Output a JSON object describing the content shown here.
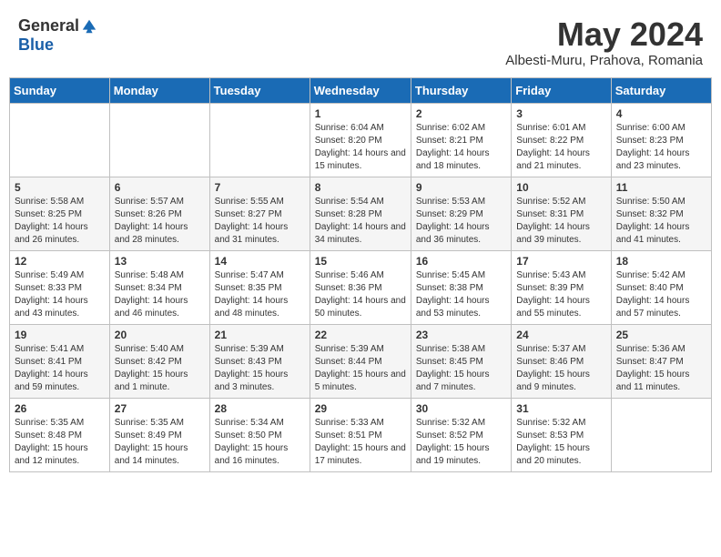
{
  "header": {
    "logo_general": "General",
    "logo_blue": "Blue",
    "month": "May 2024",
    "location": "Albesti-Muru, Prahova, Romania"
  },
  "days_of_week": [
    "Sunday",
    "Monday",
    "Tuesday",
    "Wednesday",
    "Thursday",
    "Friday",
    "Saturday"
  ],
  "weeks": [
    [
      {
        "day": "",
        "sunrise": "",
        "sunset": "",
        "daylight": ""
      },
      {
        "day": "",
        "sunrise": "",
        "sunset": "",
        "daylight": ""
      },
      {
        "day": "",
        "sunrise": "",
        "sunset": "",
        "daylight": ""
      },
      {
        "day": "1",
        "sunrise": "Sunrise: 6:04 AM",
        "sunset": "Sunset: 8:20 PM",
        "daylight": "Daylight: 14 hours and 15 minutes."
      },
      {
        "day": "2",
        "sunrise": "Sunrise: 6:02 AM",
        "sunset": "Sunset: 8:21 PM",
        "daylight": "Daylight: 14 hours and 18 minutes."
      },
      {
        "day": "3",
        "sunrise": "Sunrise: 6:01 AM",
        "sunset": "Sunset: 8:22 PM",
        "daylight": "Daylight: 14 hours and 21 minutes."
      },
      {
        "day": "4",
        "sunrise": "Sunrise: 6:00 AM",
        "sunset": "Sunset: 8:23 PM",
        "daylight": "Daylight: 14 hours and 23 minutes."
      }
    ],
    [
      {
        "day": "5",
        "sunrise": "Sunrise: 5:58 AM",
        "sunset": "Sunset: 8:25 PM",
        "daylight": "Daylight: 14 hours and 26 minutes."
      },
      {
        "day": "6",
        "sunrise": "Sunrise: 5:57 AM",
        "sunset": "Sunset: 8:26 PM",
        "daylight": "Daylight: 14 hours and 28 minutes."
      },
      {
        "day": "7",
        "sunrise": "Sunrise: 5:55 AM",
        "sunset": "Sunset: 8:27 PM",
        "daylight": "Daylight: 14 hours and 31 minutes."
      },
      {
        "day": "8",
        "sunrise": "Sunrise: 5:54 AM",
        "sunset": "Sunset: 8:28 PM",
        "daylight": "Daylight: 14 hours and 34 minutes."
      },
      {
        "day": "9",
        "sunrise": "Sunrise: 5:53 AM",
        "sunset": "Sunset: 8:29 PM",
        "daylight": "Daylight: 14 hours and 36 minutes."
      },
      {
        "day": "10",
        "sunrise": "Sunrise: 5:52 AM",
        "sunset": "Sunset: 8:31 PM",
        "daylight": "Daylight: 14 hours and 39 minutes."
      },
      {
        "day": "11",
        "sunrise": "Sunrise: 5:50 AM",
        "sunset": "Sunset: 8:32 PM",
        "daylight": "Daylight: 14 hours and 41 minutes."
      }
    ],
    [
      {
        "day": "12",
        "sunrise": "Sunrise: 5:49 AM",
        "sunset": "Sunset: 8:33 PM",
        "daylight": "Daylight: 14 hours and 43 minutes."
      },
      {
        "day": "13",
        "sunrise": "Sunrise: 5:48 AM",
        "sunset": "Sunset: 8:34 PM",
        "daylight": "Daylight: 14 hours and 46 minutes."
      },
      {
        "day": "14",
        "sunrise": "Sunrise: 5:47 AM",
        "sunset": "Sunset: 8:35 PM",
        "daylight": "Daylight: 14 hours and 48 minutes."
      },
      {
        "day": "15",
        "sunrise": "Sunrise: 5:46 AM",
        "sunset": "Sunset: 8:36 PM",
        "daylight": "Daylight: 14 hours and 50 minutes."
      },
      {
        "day": "16",
        "sunrise": "Sunrise: 5:45 AM",
        "sunset": "Sunset: 8:38 PM",
        "daylight": "Daylight: 14 hours and 53 minutes."
      },
      {
        "day": "17",
        "sunrise": "Sunrise: 5:43 AM",
        "sunset": "Sunset: 8:39 PM",
        "daylight": "Daylight: 14 hours and 55 minutes."
      },
      {
        "day": "18",
        "sunrise": "Sunrise: 5:42 AM",
        "sunset": "Sunset: 8:40 PM",
        "daylight": "Daylight: 14 hours and 57 minutes."
      }
    ],
    [
      {
        "day": "19",
        "sunrise": "Sunrise: 5:41 AM",
        "sunset": "Sunset: 8:41 PM",
        "daylight": "Daylight: 14 hours and 59 minutes."
      },
      {
        "day": "20",
        "sunrise": "Sunrise: 5:40 AM",
        "sunset": "Sunset: 8:42 PM",
        "daylight": "Daylight: 15 hours and 1 minute."
      },
      {
        "day": "21",
        "sunrise": "Sunrise: 5:39 AM",
        "sunset": "Sunset: 8:43 PM",
        "daylight": "Daylight: 15 hours and 3 minutes."
      },
      {
        "day": "22",
        "sunrise": "Sunrise: 5:39 AM",
        "sunset": "Sunset: 8:44 PM",
        "daylight": "Daylight: 15 hours and 5 minutes."
      },
      {
        "day": "23",
        "sunrise": "Sunrise: 5:38 AM",
        "sunset": "Sunset: 8:45 PM",
        "daylight": "Daylight: 15 hours and 7 minutes."
      },
      {
        "day": "24",
        "sunrise": "Sunrise: 5:37 AM",
        "sunset": "Sunset: 8:46 PM",
        "daylight": "Daylight: 15 hours and 9 minutes."
      },
      {
        "day": "25",
        "sunrise": "Sunrise: 5:36 AM",
        "sunset": "Sunset: 8:47 PM",
        "daylight": "Daylight: 15 hours and 11 minutes."
      }
    ],
    [
      {
        "day": "26",
        "sunrise": "Sunrise: 5:35 AM",
        "sunset": "Sunset: 8:48 PM",
        "daylight": "Daylight: 15 hours and 12 minutes."
      },
      {
        "day": "27",
        "sunrise": "Sunrise: 5:35 AM",
        "sunset": "Sunset: 8:49 PM",
        "daylight": "Daylight: 15 hours and 14 minutes."
      },
      {
        "day": "28",
        "sunrise": "Sunrise: 5:34 AM",
        "sunset": "Sunset: 8:50 PM",
        "daylight": "Daylight: 15 hours and 16 minutes."
      },
      {
        "day": "29",
        "sunrise": "Sunrise: 5:33 AM",
        "sunset": "Sunset: 8:51 PM",
        "daylight": "Daylight: 15 hours and 17 minutes."
      },
      {
        "day": "30",
        "sunrise": "Sunrise: 5:32 AM",
        "sunset": "Sunset: 8:52 PM",
        "daylight": "Daylight: 15 hours and 19 minutes."
      },
      {
        "day": "31",
        "sunrise": "Sunrise: 5:32 AM",
        "sunset": "Sunset: 8:53 PM",
        "daylight": "Daylight: 15 hours and 20 minutes."
      },
      {
        "day": "",
        "sunrise": "",
        "sunset": "",
        "daylight": ""
      }
    ]
  ]
}
